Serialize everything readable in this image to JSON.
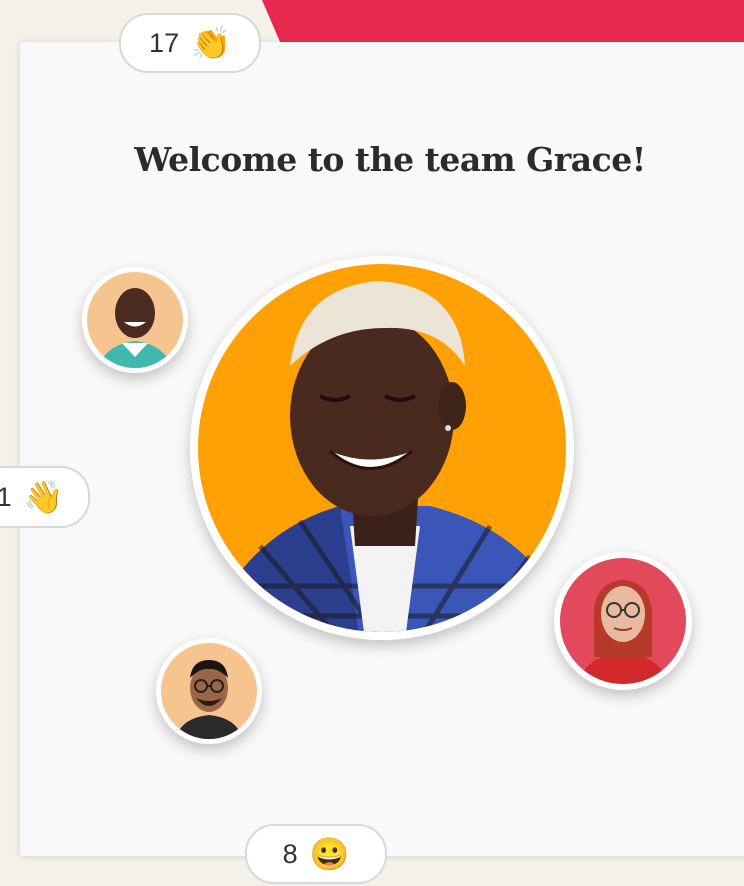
{
  "welcome_title": "Welcome to the team Grace!",
  "reactions": {
    "clap": {
      "count": "17",
      "icon": "clapping-hands-icon"
    },
    "wave": {
      "count": "1",
      "icon": "waving-hand-icon"
    },
    "smile": {
      "count": "8",
      "icon": "grinning-face-icon"
    }
  },
  "colors": {
    "accent": "#e8294f",
    "avatar_main_bg": "#ffa105",
    "avatar_peach_bg": "#f6c58f",
    "avatar_red_bg": "#e2495a"
  }
}
